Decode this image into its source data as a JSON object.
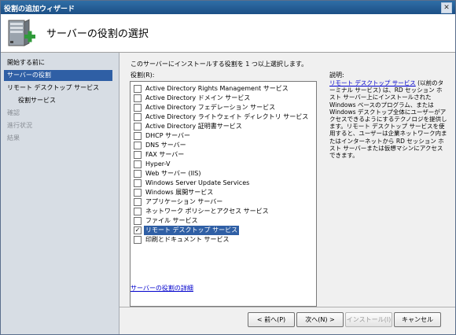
{
  "window": {
    "title": "役割の追加ウィザード",
    "close_glyph": "✕"
  },
  "header": {
    "heading": "サーバーの役割の選択"
  },
  "nav": {
    "items": [
      {
        "label": "開始する前に",
        "state": "normal"
      },
      {
        "label": "サーバーの役割",
        "state": "selected"
      },
      {
        "label": "リモート デスクトップ サービス",
        "state": "normal"
      },
      {
        "label": "役割サービス",
        "state": "sub"
      },
      {
        "label": "確認",
        "state": "disabled"
      },
      {
        "label": "進行状況",
        "state": "disabled"
      },
      {
        "label": "結果",
        "state": "disabled"
      }
    ]
  },
  "content": {
    "instruction": "このサーバーにインストールする役割を 1 つ以上選択します。",
    "roles_label": "役割(R):",
    "roles": [
      {
        "label": "Active Directory Rights Management サービス",
        "checked": false
      },
      {
        "label": "Active Directory ドメイン サービス",
        "checked": false
      },
      {
        "label": "Active Directory フェデレーション サービス",
        "checked": false
      },
      {
        "label": "Active Directory ライトウェイト ディレクトリ サービス",
        "checked": false
      },
      {
        "label": "Active Directory 証明書サービス",
        "checked": false
      },
      {
        "label": "DHCP サーバー",
        "checked": false
      },
      {
        "label": "DNS サーバー",
        "checked": false
      },
      {
        "label": "FAX サーバー",
        "checked": false
      },
      {
        "label": "Hyper-V",
        "checked": false
      },
      {
        "label": "Web サーバー (IIS)",
        "checked": false
      },
      {
        "label": "Windows Server Update Services",
        "checked": false
      },
      {
        "label": "Windows 展開サービス",
        "checked": false
      },
      {
        "label": "アプリケーション サーバー",
        "checked": false
      },
      {
        "label": "ネットワーク ポリシーとアクセス サービス",
        "checked": false
      },
      {
        "label": "ファイル サービス",
        "checked": false
      },
      {
        "label": "リモート デスクトップ サービス",
        "checked": true,
        "selected": true
      },
      {
        "label": "印刷とドキュメント サービス",
        "checked": false
      }
    ],
    "more_link": "サーバーの役割の詳細",
    "description_label": "説明:",
    "description_link": "リモート デスクトップ サービス",
    "description_text": " (以前のターミナル サービス) は、RD セッション ホスト サーバー上にインストールされた Windows ベースのプログラム、または Windows デスクトップ全体にユーザーがアクセスできるようにするテクノロジを提供します。リモート デスクトップ サービスを使用すると、ユーザーは企業ネットワーク内またはインターネットから RD セッション ホスト サーバーまたは仮想マシンにアクセスできます。"
  },
  "buttons": {
    "back": "< 前へ(P)",
    "next": "次へ(N) >",
    "install": "インストール(I)",
    "cancel": "キャンセル"
  },
  "colors": {
    "selection": "#2f5fa5",
    "nav_background": "#d7dde4",
    "link": "#0000cc"
  }
}
